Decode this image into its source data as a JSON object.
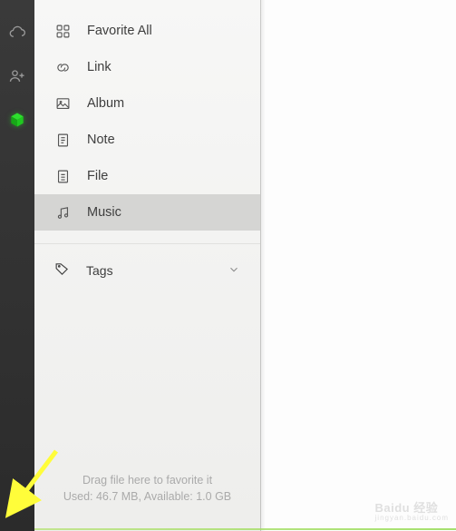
{
  "narrowbar": {
    "items": [
      {
        "name": "cloud"
      },
      {
        "name": "add-user"
      },
      {
        "name": "cube"
      }
    ]
  },
  "sidebar": {
    "items": [
      {
        "name": "favorite-all",
        "label": "Favorite All",
        "icon": "grid"
      },
      {
        "name": "link",
        "label": "Link",
        "icon": "link"
      },
      {
        "name": "album",
        "label": "Album",
        "icon": "image"
      },
      {
        "name": "note",
        "label": "Note",
        "icon": "note"
      },
      {
        "name": "file",
        "label": "File",
        "icon": "file"
      },
      {
        "name": "music",
        "label": "Music",
        "icon": "music",
        "selected": true
      }
    ],
    "tags": {
      "label": "Tags"
    },
    "drop": {
      "line1": "Drag file here to favorite it",
      "line2": "Used: 46.7 MB, Available: 1.0 GB"
    }
  },
  "colors": {
    "accent": "#1ecc1e"
  },
  "watermark": {
    "brand": "Baidu 经验",
    "sub": "jingyan.baidu.com"
  }
}
